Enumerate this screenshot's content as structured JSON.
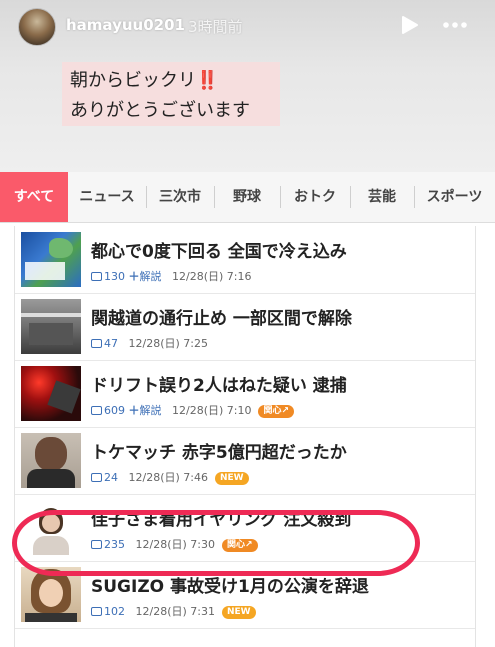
{
  "story": {
    "username": "hamayuu0201",
    "time": "3時間前",
    "caption_line1": "朝からビックリ",
    "caption_emoji": "‼️",
    "caption_line2": "ありがとうございます"
  },
  "tabs": [
    {
      "label": "すべて"
    },
    {
      "label": "ニュース"
    },
    {
      "label": "三次市"
    },
    {
      "label": "野球"
    },
    {
      "label": "おトク"
    },
    {
      "label": "芸能"
    },
    {
      "label": "スポーツ"
    }
  ],
  "news": [
    {
      "title": "都心で0度下回る 全国で冷え込み",
      "comments": "130",
      "plus": "＋",
      "kaisetsu": "解説",
      "date": "12/28(日) 7:16",
      "badge": ""
    },
    {
      "title": "関越道の通行止め 一部区間で解除",
      "comments": "47",
      "plus": "",
      "kaisetsu": "",
      "date": "12/28(日) 7:25",
      "badge": ""
    },
    {
      "title": "ドリフト誤り2人はねた疑い 逮捕",
      "comments": "609",
      "plus": "＋",
      "kaisetsu": "解説",
      "date": "12/28(日) 7:10",
      "badge": "関心↗"
    },
    {
      "title": "トケマッチ 赤字5億円超だったか",
      "comments": "24",
      "plus": "",
      "kaisetsu": "",
      "date": "12/28(日) 7:46",
      "badge": "NEW"
    },
    {
      "title": "佳子さま着用イヤリング 注文殺到",
      "comments": "235",
      "plus": "",
      "kaisetsu": "",
      "date": "12/28(日) 7:30",
      "badge": "関心↗"
    },
    {
      "title": "SUGIZO 事故受け1月の公演を辞退",
      "comments": "102",
      "plus": "",
      "kaisetsu": "",
      "date": "12/28(日) 7:31",
      "badge": "NEW"
    }
  ],
  "colors": {
    "accent": "#fa5a6a",
    "circle": "#ee2a55",
    "link": "#3d6fb6",
    "badge_new": "#f5a623",
    "badge_kanshin": "#f08a24"
  }
}
